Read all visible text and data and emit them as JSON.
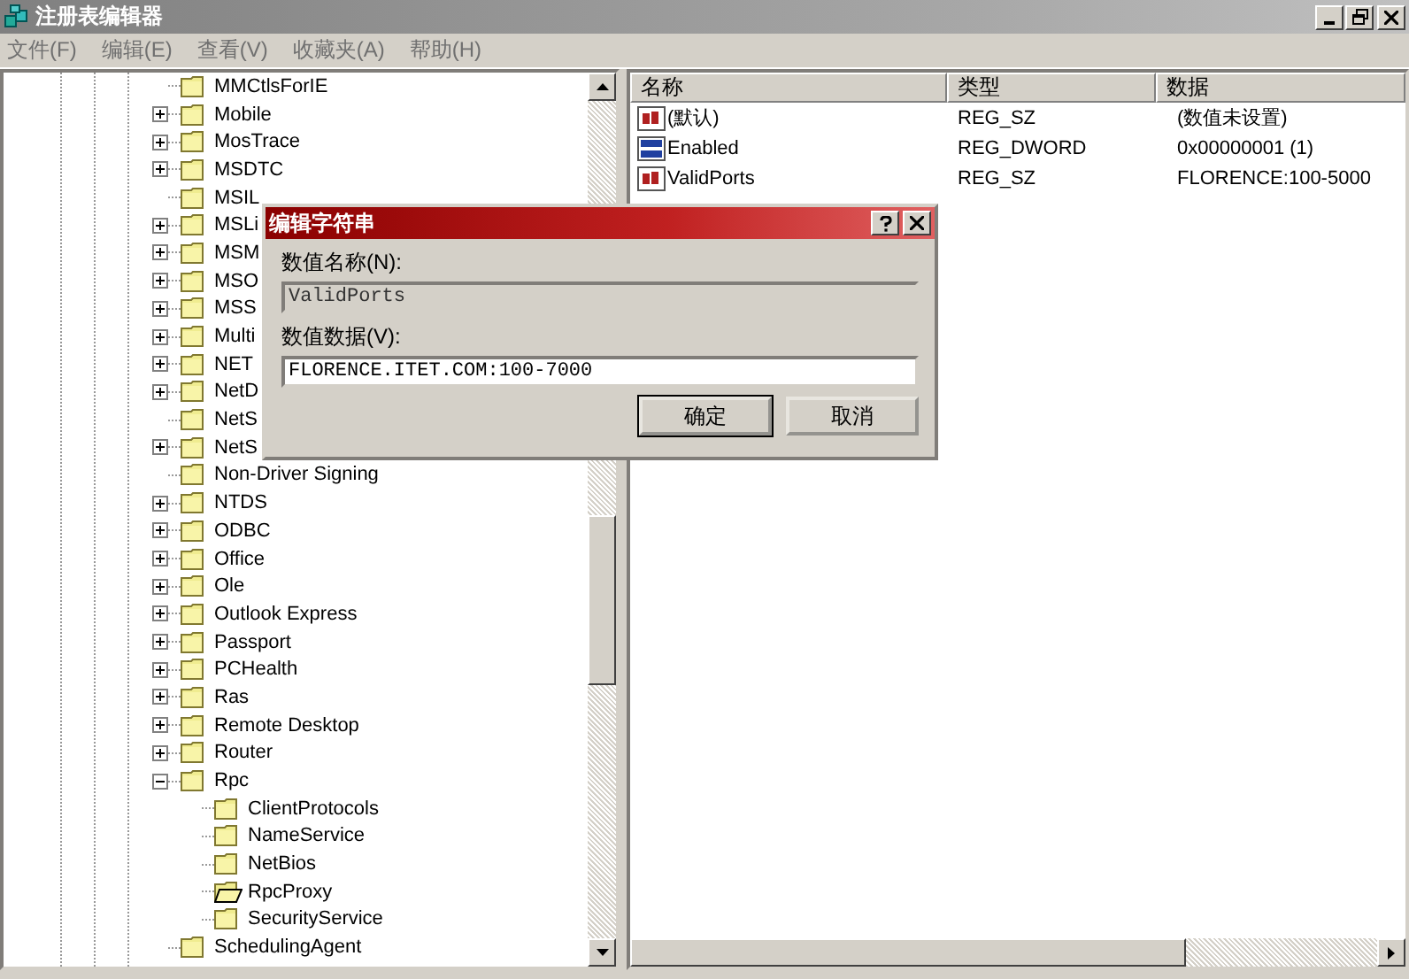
{
  "window": {
    "title": "注册表编辑器"
  },
  "menu": [
    "文件(F)",
    "编辑(E)",
    "查看(V)",
    "收藏夹(A)",
    "帮助(H)"
  ],
  "tree": {
    "items": [
      {
        "label": "MMCtlsForIE",
        "expandable": false,
        "expanded": false,
        "selected": false
      },
      {
        "label": "Mobile",
        "expandable": true,
        "expanded": false,
        "selected": false
      },
      {
        "label": "MosTrace",
        "expandable": true,
        "expanded": false,
        "selected": false
      },
      {
        "label": "MSDTC",
        "expandable": true,
        "expanded": false,
        "selected": false
      },
      {
        "label": "MSIL",
        "expandable": false,
        "expanded": false,
        "selected": false
      },
      {
        "label": "MSLi",
        "expandable": true,
        "expanded": false,
        "selected": false
      },
      {
        "label": "MSM",
        "expandable": true,
        "expanded": false,
        "selected": false
      },
      {
        "label": "MSO",
        "expandable": true,
        "expanded": false,
        "selected": false
      },
      {
        "label": "MSS",
        "expandable": true,
        "expanded": false,
        "selected": false
      },
      {
        "label": "Multi",
        "expandable": true,
        "expanded": false,
        "selected": false
      },
      {
        "label": "NET",
        "expandable": true,
        "expanded": false,
        "selected": false
      },
      {
        "label": "NetD",
        "expandable": true,
        "expanded": false,
        "selected": false
      },
      {
        "label": "NetS",
        "expandable": false,
        "expanded": false,
        "selected": false
      },
      {
        "label": "NetS",
        "expandable": true,
        "expanded": false,
        "selected": false
      },
      {
        "label": "Non-Driver Signing",
        "expandable": false,
        "expanded": false,
        "selected": false
      },
      {
        "label": "NTDS",
        "expandable": true,
        "expanded": false,
        "selected": false
      },
      {
        "label": "ODBC",
        "expandable": true,
        "expanded": false,
        "selected": false
      },
      {
        "label": "Office",
        "expandable": true,
        "expanded": false,
        "selected": false
      },
      {
        "label": "Ole",
        "expandable": true,
        "expanded": false,
        "selected": false
      },
      {
        "label": "Outlook Express",
        "expandable": true,
        "expanded": false,
        "selected": false
      },
      {
        "label": "Passport",
        "expandable": true,
        "expanded": false,
        "selected": false
      },
      {
        "label": "PCHealth",
        "expandable": true,
        "expanded": false,
        "selected": false
      },
      {
        "label": "Ras",
        "expandable": true,
        "expanded": false,
        "selected": false
      },
      {
        "label": "Remote Desktop",
        "expandable": true,
        "expanded": false,
        "selected": false
      },
      {
        "label": "Router",
        "expandable": true,
        "expanded": false,
        "selected": false
      },
      {
        "label": "Rpc",
        "expandable": true,
        "expanded": true,
        "selected": false,
        "children": [
          {
            "label": "ClientProtocols",
            "expandable": false,
            "expanded": false,
            "selected": false
          },
          {
            "label": "NameService",
            "expandable": false,
            "expanded": false,
            "selected": false
          },
          {
            "label": "NetBios",
            "expandable": false,
            "expanded": false,
            "selected": false
          },
          {
            "label": "RpcProxy",
            "expandable": false,
            "expanded": false,
            "selected": true
          },
          {
            "label": "SecurityService",
            "expandable": false,
            "expanded": false,
            "selected": false
          }
        ]
      },
      {
        "label": "SchedulingAgent",
        "expandable": false,
        "expanded": false,
        "selected": false
      }
    ]
  },
  "values": {
    "columns": [
      "名称",
      "类型",
      "数据"
    ],
    "rows": [
      {
        "kind": "string",
        "name": "(默认)",
        "type": "REG_SZ",
        "data": "(数值未设置)"
      },
      {
        "kind": "dword",
        "name": "Enabled",
        "type": "REG_DWORD",
        "data": "0x00000001 (1)"
      },
      {
        "kind": "string",
        "name": "ValidPorts",
        "type": "REG_SZ",
        "data": "FLORENCE:100-5000"
      }
    ]
  },
  "dialog": {
    "title": "编辑字符串",
    "name_label": "数值名称(N):",
    "name_value": "ValidPorts",
    "data_label": "数值数据(V):",
    "data_value": "FLORENCE.ITET.COM:100-7000",
    "buttons": [
      {
        "label": "确定",
        "default": true
      },
      {
        "label": "取消",
        "default": false
      }
    ]
  }
}
